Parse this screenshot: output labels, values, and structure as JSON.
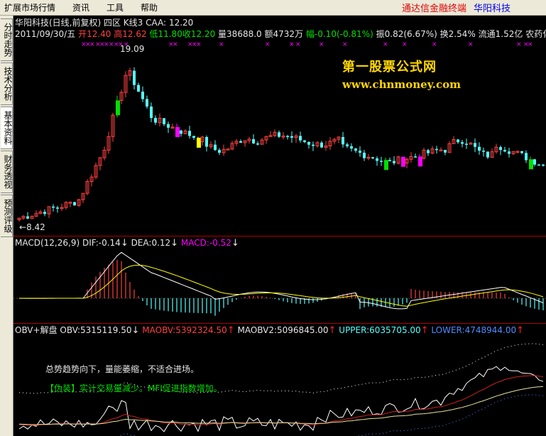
{
  "menu": {
    "items": [
      "扩展市场行情",
      "资讯",
      "工具",
      "帮助"
    ],
    "brand": "通达信金融终端",
    "stock": "华阳科技"
  },
  "sidebar": {
    "tabs": [
      "分时走势",
      "技术分析",
      "基本资料",
      "财务透视",
      "预测评级"
    ]
  },
  "kline": {
    "header": "华阳科技(日线,前复权) 四区 K线3",
    "caa_label": "CAA:",
    "caa_value": "12.20",
    "date": "2011/09/30/五",
    "open_label": "开",
    "open": "12.40",
    "high_label": "高",
    "high": "12.62",
    "low_label": "低",
    "low": "11.80",
    "close_label": "收",
    "close": "12.20",
    "volume_label": "量",
    "volume": "38688.0",
    "amount_label": "额",
    "amount": "4732万",
    "change_label": "幅",
    "change": "-0.10(-0.81%)",
    "amplitude_label": "振",
    "amplitude": "0.82(6.67%)",
    "turnover_label": "换",
    "turnover": "2.54%",
    "float_label": "流通",
    "float": "1.52亿",
    "sector": "农药化肥",
    "peak_label": "19.09",
    "trough_label": "8.42",
    "watermark_title": "第一股票公式网",
    "watermark_url": "www.chnmoney.com"
  },
  "macd": {
    "title": "MACD(12,26,9)",
    "dif_label": "DIF:",
    "dif": "-0.14",
    "dea_label": "DEA:",
    "dea": "0.12",
    "macd_label": "MACD:",
    "macd": "-0.52"
  },
  "obv": {
    "title": "OBV+解盘",
    "obv_label": "OBV:",
    "obv": "5315119.50",
    "maobv_label": "MAOBV:",
    "maobv": "5392324.50",
    "maobv2_label": "MAOBV2:",
    "maobv2": "5096845.00",
    "upper_label": "UPPER:",
    "upper": "6035705.00",
    "lower_label": "LOWER:",
    "lower": "4748944.00",
    "note1": "总势趋势向下，量能萎缩，不适合进场。",
    "note2": "【伪装】实计交易量减少。MFI促进指数增加。"
  },
  "colors": {
    "up": "#ff4040",
    "down": "#54ffff",
    "highlight_green": "#00e000",
    "highlight_magenta": "#ff00ff",
    "highlight_yellow": "#ffff00",
    "separator": "#b00000"
  }
}
